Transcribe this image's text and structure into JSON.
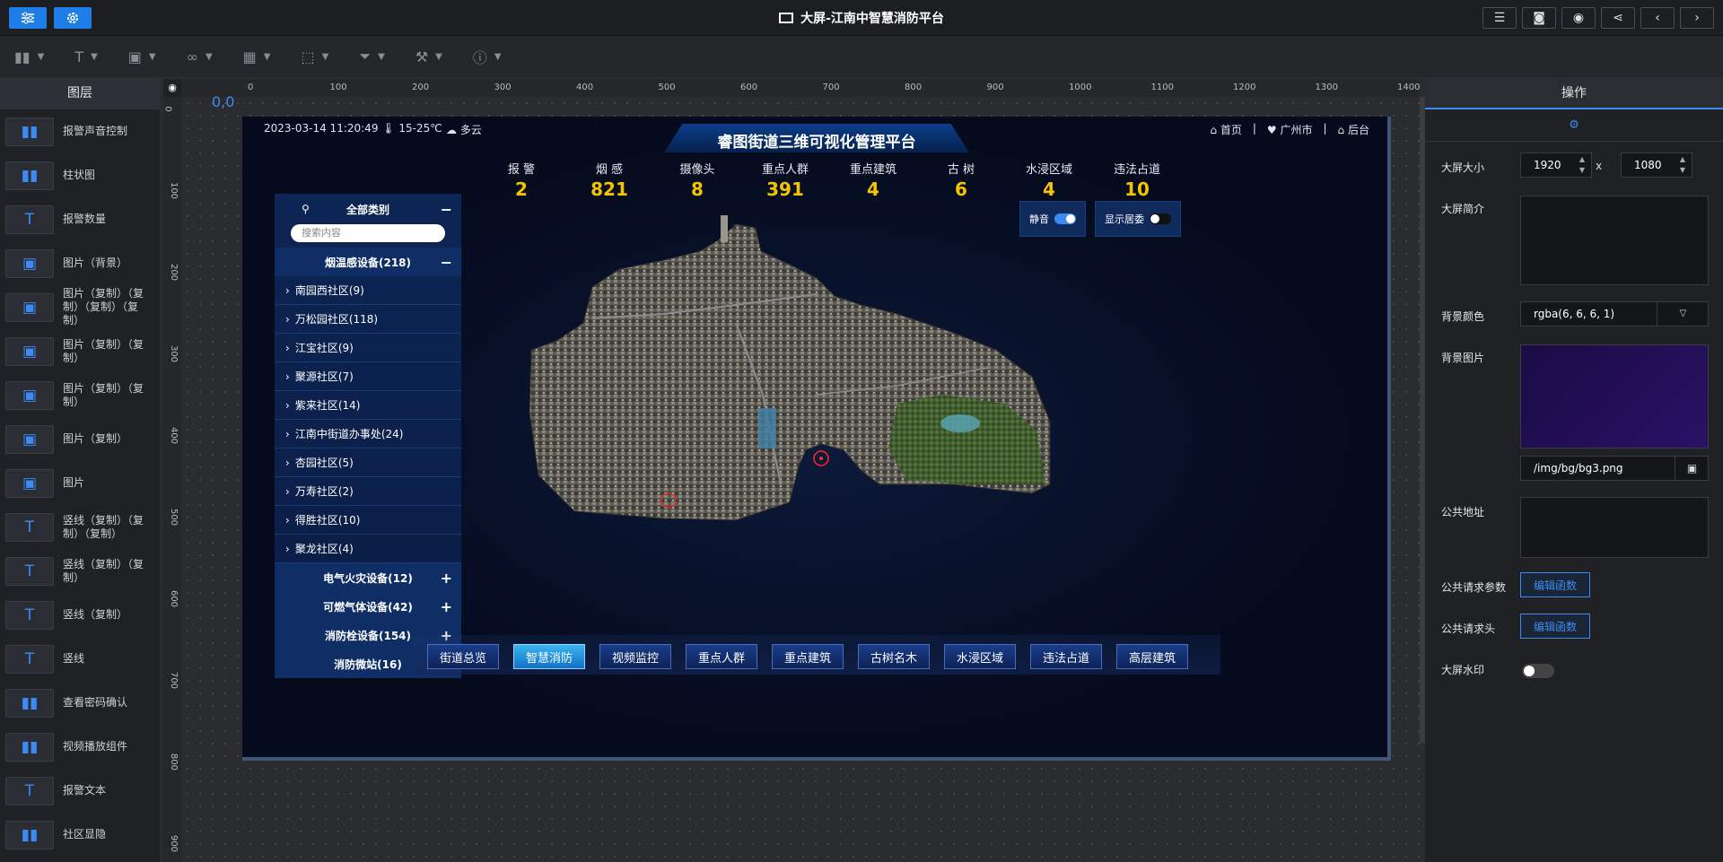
{
  "header": {
    "title": "大屏-江南中智慧消防平台"
  },
  "toolbar": {
    "tools": [
      "chart-icon",
      "text-icon",
      "image-icon",
      "component-icon",
      "table-icon",
      "border-icon",
      "filter-icon",
      "brush-icon",
      "info-icon"
    ]
  },
  "layers": {
    "title": "图层",
    "items": [
      {
        "icon": "chart-icon",
        "label": "报警声音控制"
      },
      {
        "icon": "chart-icon",
        "label": "柱状图"
      },
      {
        "icon": "text-icon",
        "label": "报警数量"
      },
      {
        "icon": "image-icon",
        "label": "图片（背景）"
      },
      {
        "icon": "image-icon",
        "label": "图片（复制）（复制）（复制）（复制）"
      },
      {
        "icon": "image-icon",
        "label": "图片（复制）（复制）"
      },
      {
        "icon": "image-icon",
        "label": "图片（复制）（复制）"
      },
      {
        "icon": "image-icon",
        "label": "图片（复制）"
      },
      {
        "icon": "image-icon",
        "label": "图片"
      },
      {
        "icon": "text-icon",
        "label": "竖线（复制）（复制）（复制）"
      },
      {
        "icon": "text-icon",
        "label": "竖线（复制）（复制）"
      },
      {
        "icon": "text-icon",
        "label": "竖线（复制）"
      },
      {
        "icon": "text-icon",
        "label": "竖线"
      },
      {
        "icon": "chart-icon",
        "label": "查看密码确认"
      },
      {
        "icon": "chart-icon",
        "label": "视频播放组件"
      },
      {
        "icon": "text-icon",
        "label": "报警文本"
      },
      {
        "icon": "chart-icon",
        "label": "社区显隐"
      }
    ]
  },
  "ruler": {
    "top": [
      "0",
      "100",
      "200",
      "300",
      "400",
      "500",
      "600",
      "700",
      "800",
      "900",
      "1000",
      "1100",
      "1200",
      "1300",
      "1400"
    ],
    "left": [
      "0",
      "100",
      "200",
      "300",
      "400",
      "500",
      "600",
      "700",
      "800",
      "900"
    ],
    "origin": "0,0"
  },
  "screen": {
    "datetime": "2023-03-14 11:20:49",
    "temp": "15-25℃",
    "weather": "多云",
    "title": "睿图街道三维可视化管理平台",
    "nav": {
      "home": "首页",
      "city": "广州市",
      "backend": "后台"
    },
    "stats": [
      {
        "label": "报 警",
        "value": "2"
      },
      {
        "label": "烟 感",
        "value": "821"
      },
      {
        "label": "摄像头",
        "value": "8"
      },
      {
        "label": "重点人群",
        "value": "391"
      },
      {
        "label": "重点建筑",
        "value": "4"
      },
      {
        "label": "古 树",
        "value": "6"
      },
      {
        "label": "水浸区域",
        "value": "4"
      },
      {
        "label": "违法占道",
        "value": "10"
      }
    ],
    "toggles": {
      "mute": "静音",
      "show_committee": "显示居委"
    },
    "tree": {
      "all": "全部类别",
      "search_placeholder": "搜索内容",
      "category1": "烟温感设备(218)",
      "items": [
        "南园西社区(9)",
        "万松园社区(118)",
        "江宝社区(9)",
        "聚源社区(7)",
        "紫来社区(14)",
        "江南中街道办事处(24)",
        "杏园社区(5)",
        "万寿社区(2)",
        "得胜社区(10)",
        "聚龙社区(4)"
      ],
      "categories": [
        "电气火灾设备(12)",
        "可燃气体设备(42)",
        "消防栓设备(154)",
        "消防微站(16)"
      ]
    },
    "bottom_nav": [
      {
        "label": "街道总览"
      },
      {
        "label": "智慧消防"
      },
      {
        "label": "视频监控"
      },
      {
        "label": "重点人群"
      },
      {
        "label": "重点建筑"
      },
      {
        "label": "古树名木"
      },
      {
        "label": "水浸区域"
      },
      {
        "label": "违法占道"
      },
      {
        "label": "高层建筑"
      }
    ],
    "active_nav": "智慧消防"
  },
  "panel": {
    "title": "操作",
    "size_label": "大屏大小",
    "width": "1920",
    "height": "1080",
    "x": "x",
    "intro_label": "大屏简介",
    "bgcolor_label": "背景颜色",
    "bgcolor": "rgba(6, 6, 6, 1)",
    "bgimg_label": "背景图片",
    "bgimg_path": "/img/bg/bg3.png",
    "address_label": "公共地址",
    "params_label": "公共请求参数",
    "params_btn": "编辑函数",
    "headers_label": "公共请求头",
    "headers_btn": "编辑函数",
    "watermark_label": "大屏水印"
  },
  "colors": {
    "accent": "#3d8bf2",
    "yellow": "#f5c400",
    "panel": "#1f2125"
  }
}
